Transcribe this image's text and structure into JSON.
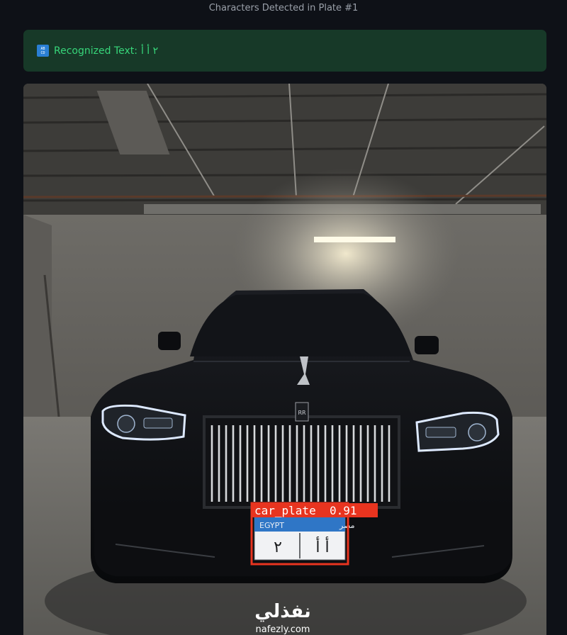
{
  "caption": "Characters Detected in Plate #1",
  "alert": {
    "icon": "abc-text-icon",
    "icon_lines": [
      "AB",
      "CD"
    ],
    "label": "Recognized Text:",
    "value": "٢ أ أ"
  },
  "image": {
    "detection_label": "car_plate  0.91",
    "plate_top_left": "EGYPT",
    "plate_top_right": "مصر",
    "plate_left_char": "٢",
    "plate_right_chars": "أ أ",
    "grille_emblem": "RR",
    "watermark_arabic": "نفذلي",
    "watermark_url": "nafezly.com"
  },
  "colors": {
    "background": "#0e1117",
    "alert_bg": "#173928",
    "alert_text": "#37d67a",
    "detection_box": "#e8341f",
    "plate_band": "#2f76c6"
  }
}
